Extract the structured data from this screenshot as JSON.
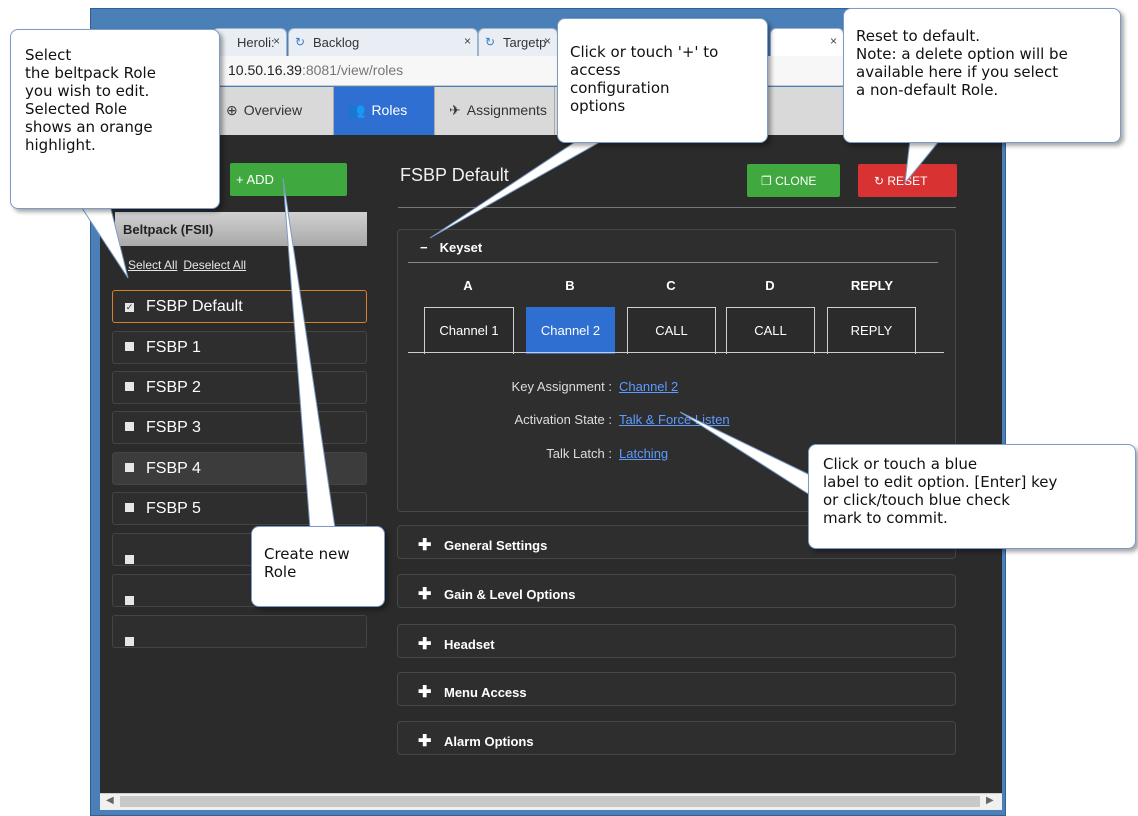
{
  "browser": {
    "tabs": [
      {
        "label": "Heroli:"
      },
      {
        "label": "Backlog"
      },
      {
        "label": "Targetp"
      },
      {
        "label": ""
      }
    ],
    "url_host": "10.50.16.39",
    "url_rest": ":8081/view/roles"
  },
  "nav": {
    "overview": "Overview",
    "roles": "Roles",
    "assignments": "Assignments"
  },
  "sidebar": {
    "add_label": "ADD",
    "group": "Beltpack (FSII)",
    "select_all": "Select All",
    "deselect_all": "Deselect All",
    "roles": [
      {
        "label": "FSBP Default",
        "selected": true
      },
      {
        "label": "FSBP 1"
      },
      {
        "label": "FSBP 2"
      },
      {
        "label": "FSBP 3"
      },
      {
        "label": "FSBP 4"
      },
      {
        "label": "FSBP 5"
      },
      {
        "label": ""
      },
      {
        "label": ""
      },
      {
        "label": ""
      }
    ]
  },
  "main": {
    "title": "FSBP Default",
    "clone_label": "CLONE",
    "reset_label": "RESET",
    "keyset": {
      "title": "Keyset",
      "keys": [
        "A",
        "B",
        "C",
        "D",
        "REPLY"
      ],
      "values": [
        "Channel 1",
        "Channel 2",
        "CALL",
        "CALL",
        "REPLY"
      ],
      "active_index": 1
    },
    "props": [
      {
        "label": "Key Assignment :",
        "value": "Channel 2"
      },
      {
        "label": "Activation State :",
        "value": "Talk & Force Listen"
      },
      {
        "label": "Talk Latch :",
        "value": "Latching"
      }
    ],
    "sections": [
      "General Settings",
      "Gain & Level Options",
      "Headset",
      "Menu Access",
      "Alarm Options"
    ]
  },
  "callouts": {
    "select_role": "Select\nthe beltpack Role\nyou wish to edit.\nSelected Role\nshows an orange\nhighlight.",
    "plus": "Click or touch '+' to\naccess\nconfiguration\noptions",
    "reset": "Reset to default.\nNote: a delete option will be\navailable here if you select\na non-default Role.",
    "blue_label": "Click or touch  a blue\nlabel to edit option. [Enter] key\nor click/touch blue check\nmark to commit.",
    "new_role": "Create new\nRole"
  },
  "colors": {
    "accent_blue": "#2f6fd1",
    "add_green": "#3fa83f",
    "reset_red": "#d93232",
    "selected_orange": "#d4812a",
    "link_blue": "#5d9bff"
  }
}
